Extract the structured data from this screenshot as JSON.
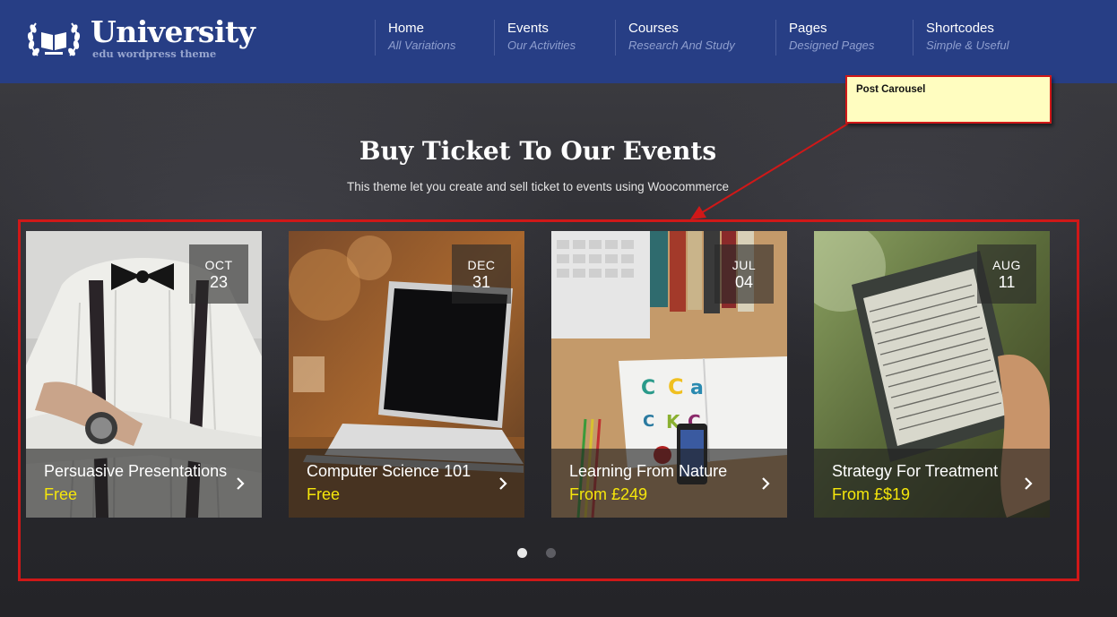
{
  "logo": {
    "title": "University",
    "subtitle": "edu wordpress theme",
    "emblem_icon": "open-book-laurel-icon"
  },
  "nav": [
    {
      "label": "Home",
      "sub": "All Variations"
    },
    {
      "label": "Events",
      "sub": "Our Activities"
    },
    {
      "label": "Courses",
      "sub": "Research And Study"
    },
    {
      "label": "Pages",
      "sub": "Designed Pages"
    },
    {
      "label": "Shortcodes",
      "sub": "Simple & Useful"
    }
  ],
  "hero": {
    "title": "Buy Ticket To Our Events",
    "subtitle": "This theme let you create and sell ticket to events using Woocommerce"
  },
  "annotation": {
    "label": "Post Carousel"
  },
  "events": [
    {
      "month": "OCT",
      "day": "23",
      "title": "Persuasive Presentations",
      "price": "Free"
    },
    {
      "month": "DEC",
      "day": "31",
      "title": "Computer Science 101",
      "price": "Free"
    },
    {
      "month": "JUL",
      "day": "04",
      "title": "Learning From Nature",
      "price": "From £249"
    },
    {
      "month": "AUG",
      "day": "11",
      "title": "Strategy For Treatment",
      "price": "From £$19"
    }
  ],
  "pager": {
    "pages": 2,
    "active_page": 1
  },
  "colors": {
    "header_bg": "#273e85",
    "price": "#f5e60b",
    "annotation_border": "#d01818",
    "annotation_bg": "#fffdc0"
  }
}
